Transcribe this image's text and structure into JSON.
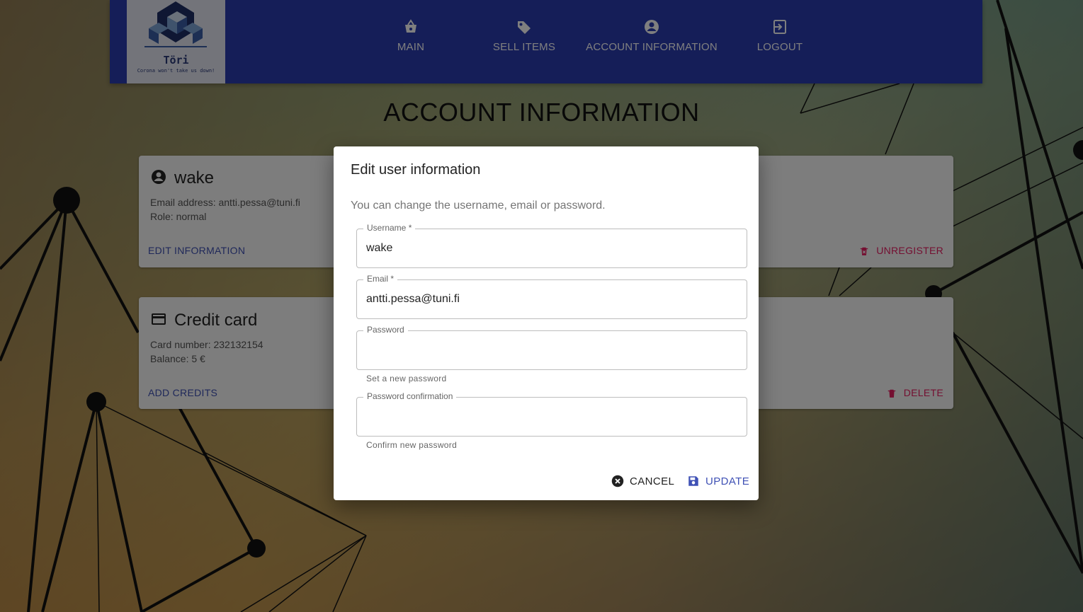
{
  "app": {
    "logo_name": "Töri",
    "logo_tagline": "Corona won't take us down!",
    "nav": [
      {
        "label": "MAIN",
        "icon": "basket-icon"
      },
      {
        "label": "SELL ITEMS",
        "icon": "tag-icon"
      },
      {
        "label": "ACCOUNT INFORMATION",
        "icon": "account-circle-icon"
      },
      {
        "label": "LOGOUT",
        "icon": "logout-icon"
      }
    ]
  },
  "page": {
    "title": "ACCOUNT INFORMATION"
  },
  "user_card": {
    "username": "wake",
    "email_line": "Email address: antti.pessa@tuni.fi",
    "role_line": "Role: normal",
    "edit_label": "EDIT INFORMATION",
    "unregister_label": "UNREGISTER"
  },
  "credit_card": {
    "title": "Credit card",
    "number_line": "Card number: 232132154",
    "balance_line": "Balance: 5 €",
    "add_label": "ADD CREDITS",
    "delete_label": "DELETE"
  },
  "dialog": {
    "title": "Edit user information",
    "description": "You can change the username, email or password.",
    "username_label": "Username *",
    "username_value": "wake",
    "email_label": "Email *",
    "email_value": "antti.pessa@tuni.fi",
    "password_label": "Password",
    "password_value": "",
    "password_helper": "Set a new password",
    "confirm_label": "Password confirmation",
    "confirm_value": "",
    "confirm_helper": "Confirm new password",
    "cancel_label": "CANCEL",
    "update_label": "UPDATE"
  },
  "colors": {
    "appbar": "#2b3db0",
    "primary": "#3f51b5",
    "danger": "#e91e63"
  }
}
